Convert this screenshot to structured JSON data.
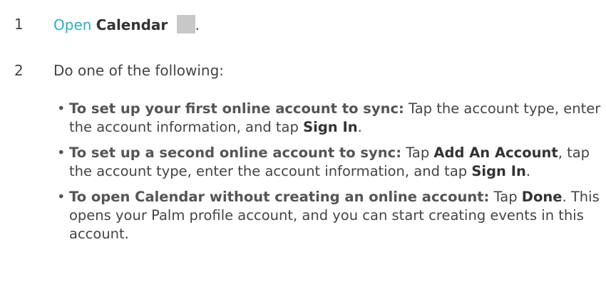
{
  "steps": [
    {
      "number": "1",
      "link_text": "Open",
      "app_name": "Calendar",
      "icon": "calendar-app-icon",
      "trailing": "."
    },
    {
      "number": "2",
      "text": "Do one of the following:"
    }
  ],
  "options": [
    {
      "lead": "To set up your first online account to sync:",
      "t1": " Tap the account type, enter the account information, and tap ",
      "b1": "Sign In",
      "t2": "."
    },
    {
      "lead": "To set up a second online account to sync:",
      "t1": " Tap ",
      "b1": "Add An Account",
      "t2": ", tap the account type, enter the account information, and tap ",
      "b2": "Sign In",
      "t3": "."
    },
    {
      "lead": "To open Calendar without creating an online account:",
      "t1": " Tap ",
      "b1": "Done",
      "t2": ". This opens your Palm profile account, and you can start creating events in this account."
    }
  ],
  "colors": {
    "link": "#2bb0c8",
    "text": "#444444",
    "icon_placeholder": "#c8c8c8"
  }
}
